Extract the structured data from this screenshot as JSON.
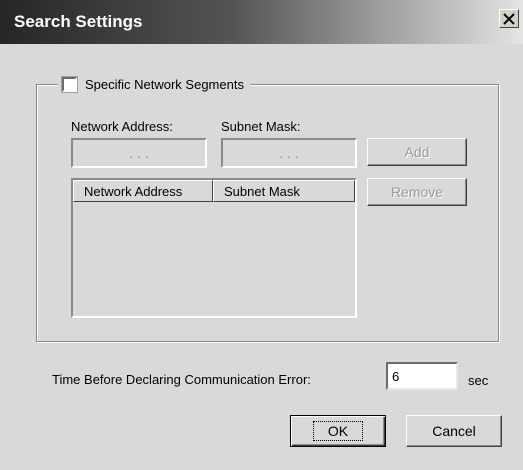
{
  "window": {
    "title": "Search Settings"
  },
  "segments": {
    "checkbox_label": "Specific Network Segments",
    "checked": false,
    "network_address_label": "Network Address:",
    "subnet_mask_label": "Subnet Mask:",
    "ip_dots": ".   .   .",
    "add_label": "Add",
    "remove_label": "Remove",
    "list_columns": [
      "Network Address",
      "Subnet Mask"
    ]
  },
  "timeout": {
    "label": "Time Before Declaring Communication Error:",
    "value": "6",
    "unit": "sec"
  },
  "buttons": {
    "ok": "OK",
    "cancel": "Cancel"
  }
}
